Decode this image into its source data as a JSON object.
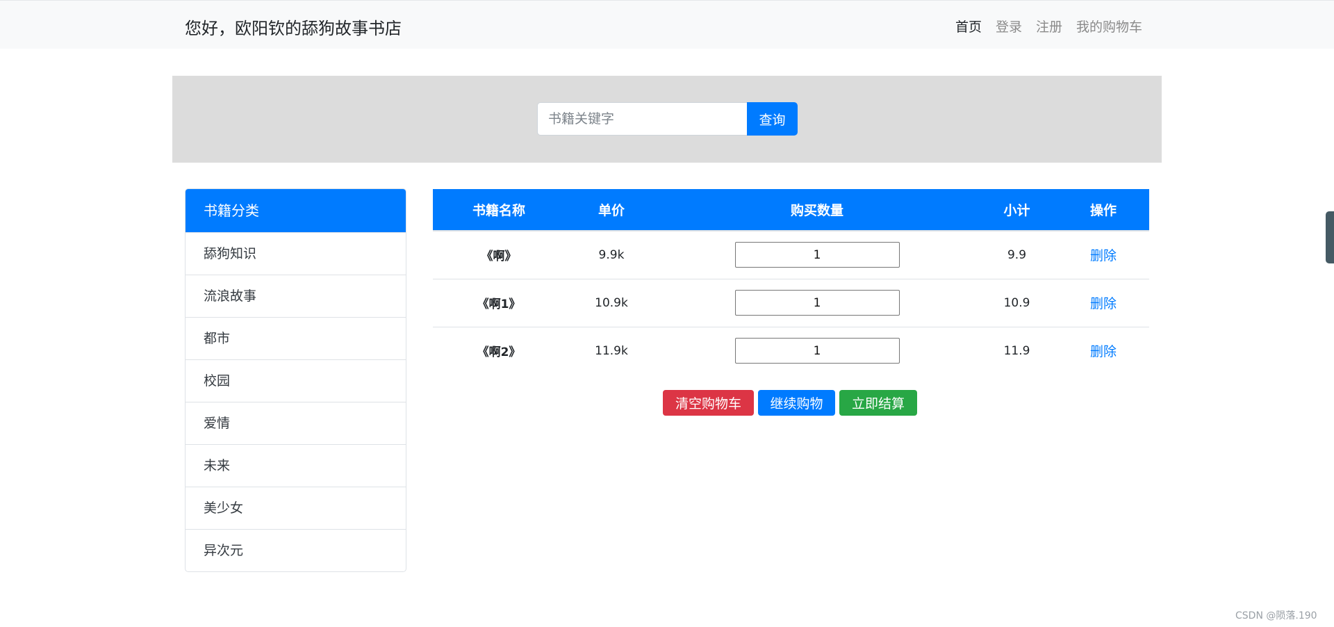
{
  "navbar": {
    "brand": "您好，欧阳钦的舔狗故事书店",
    "links": [
      {
        "label": "首页",
        "active": true
      },
      {
        "label": "登录",
        "active": false
      },
      {
        "label": "注册",
        "active": false
      },
      {
        "label": "我的购物车",
        "active": false
      }
    ]
  },
  "search": {
    "placeholder": "书籍关键字",
    "value": "",
    "button_label": "查询"
  },
  "categories": {
    "header": "书籍分类",
    "items": [
      "舔狗知识",
      "流浪故事",
      "都市",
      "校园",
      "爱情",
      "未来",
      "美少女",
      "异次元"
    ]
  },
  "cart": {
    "headers": [
      "书籍名称",
      "单价",
      "购买数量",
      "小计",
      "操作"
    ],
    "rows": [
      {
        "name": "《啊》",
        "price": "9.9k",
        "quantity": "1",
        "subtotal": "9.9",
        "action": "删除"
      },
      {
        "name": "《啊1》",
        "price": "10.9k",
        "quantity": "1",
        "subtotal": "10.9",
        "action": "删除"
      },
      {
        "name": "《啊2》",
        "price": "11.9k",
        "quantity": "1",
        "subtotal": "11.9",
        "action": "删除"
      }
    ],
    "buttons": {
      "clear": "清空购物车",
      "continue": "继续购物",
      "checkout": "立即结算"
    }
  },
  "watermark": "CSDN @陨落.190",
  "colors": {
    "primary": "#007bff",
    "danger": "#dc3545",
    "success": "#28a745",
    "navbar_bg": "#f8f9fa",
    "search_band_bg": "#dcdcdc"
  }
}
